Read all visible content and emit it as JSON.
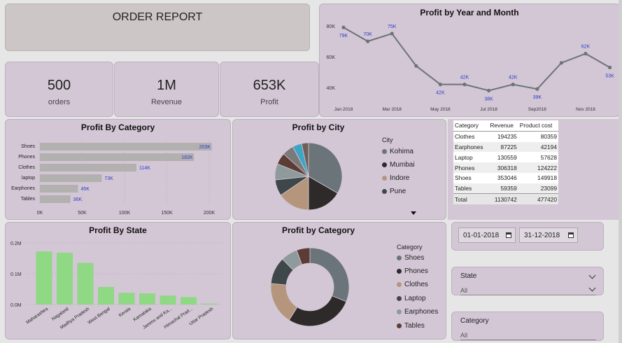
{
  "report_title": "ORDER REPORT",
  "kpis": [
    {
      "value": "500",
      "label": "orders"
    },
    {
      "value": "1M",
      "label": "Revenue"
    },
    {
      "value": "653K",
      "label": "Profit"
    }
  ],
  "colors": {
    "panel_bg": "#d3c6d5",
    "line": "#6b7478",
    "data_label": "#2b3fc7",
    "bar_grey": "#b3b0b0",
    "bar_green": "#8fd884",
    "slices": [
      "#6b7478",
      "#2e2a2a",
      "#b5967c",
      "#3e474a",
      "#8e9a9c",
      "#5b3d35",
      "#7a7a7a",
      "#3ea5c4",
      "#6e5f58"
    ]
  },
  "chart_data": [
    {
      "id": "profit-by-year-month",
      "type": "line",
      "title": "Profit by Year and Month",
      "xlabel": "",
      "ylabel": "",
      "ylim": [
        30,
        85
      ],
      "y_ticks": [
        "40K",
        "60K",
        "80K"
      ],
      "x_ticks": [
        "Jan 2018",
        "Mar 2018",
        "May 2018",
        "Jul 2018",
        "Sep2018",
        "Nov 2018"
      ],
      "x": [
        "Jan 2018",
        "Feb 2018",
        "Mar 2018",
        "Apr 2018",
        "May 2018",
        "Jun 2018",
        "Jul 2018",
        "Aug 2018",
        "Sep 2018",
        "Oct 2018",
        "Nov 2018",
        "Dec 2018"
      ],
      "values": [
        79,
        70,
        75,
        54,
        42,
        42,
        38,
        42,
        39,
        56,
        62,
        53
      ],
      "labels": [
        "79K",
        "70K",
        "75K",
        "",
        "42K",
        "42K",
        "38K",
        "42K",
        "39K",
        "",
        "62K",
        "53K"
      ]
    },
    {
      "id": "profit-by-category-bar",
      "type": "bar",
      "orientation": "horizontal",
      "title": "Profit By Category",
      "categories": [
        "Shoes",
        "Phones",
        "Clothes",
        "laptop",
        "Earphones",
        "Tables"
      ],
      "values": [
        203,
        182,
        114,
        73,
        45,
        36
      ],
      "labels": [
        "203K",
        "182K",
        "114K",
        "73K",
        "45K",
        "36K"
      ],
      "x_ticks": [
        "0K",
        "50K",
        "100K",
        "150K",
        "200K"
      ],
      "xlim": [
        0,
        220
      ]
    },
    {
      "id": "profit-by-city",
      "type": "pie",
      "title": "Profit by City",
      "legend_title": "City",
      "legend": [
        "Kohima",
        "Mumbai",
        "Indore",
        "Pune"
      ],
      "values": [
        30,
        15,
        14,
        7,
        7,
        5,
        5,
        4,
        3
      ]
    },
    {
      "id": "category-table",
      "type": "table",
      "columns": [
        "Category",
        "Revenue",
        "Product cost"
      ],
      "rows": [
        [
          "Clothes",
          "194235",
          "80359"
        ],
        [
          "Earphones",
          "87225",
          "42194"
        ],
        [
          "Laptop",
          "130559",
          "57628"
        ],
        [
          "Phones",
          "306318",
          "124222"
        ],
        [
          "Shoes",
          "353046",
          "149918"
        ],
        [
          "Tables",
          "59359",
          "23099"
        ]
      ],
      "total": [
        "Total",
        "1130742",
        "477420"
      ]
    },
    {
      "id": "profit-by-state",
      "type": "bar",
      "title": "Profit By State",
      "categories": [
        "Maharashtra",
        "Nagaland",
        "Madhya Pradesh",
        "West Bengal",
        "Kerala",
        "Karnataka",
        "Jammu and Ka...",
        "Himachal Prad...",
        "Uttar Pradesh"
      ],
      "values": [
        0.172,
        0.168,
        0.135,
        0.057,
        0.038,
        0.036,
        0.029,
        0.024,
        0.003
      ],
      "y_ticks": [
        "0.0M",
        "0.1M",
        "0.2M"
      ],
      "ylim": [
        0,
        0.2
      ]
    },
    {
      "id": "profit-by-category-donut",
      "type": "pie",
      "title": "Profit by Category",
      "legend_title": "Category",
      "legend": [
        "Shoes",
        "Phones",
        "Clothes",
        "Laptop",
        "Earphones",
        "Tables"
      ],
      "values": [
        203,
        182,
        114,
        73,
        45,
        36
      ]
    }
  ],
  "filters": {
    "date_from": "01-01-2018",
    "date_to": "31-12-2018",
    "state_label": "State",
    "state_value": "All",
    "category_label": "Category",
    "category_value": "All"
  }
}
